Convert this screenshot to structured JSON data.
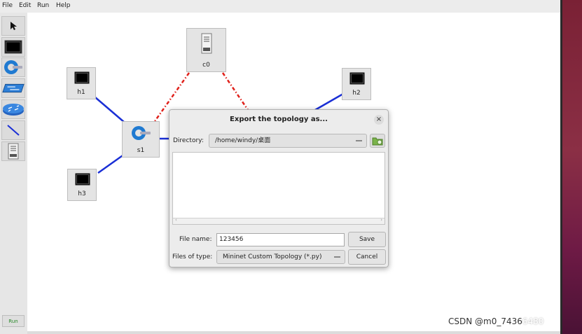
{
  "menu": [
    "File",
    "Edit",
    "Run",
    "Help"
  ],
  "toolbar": {
    "tools": [
      {
        "name": "select-tool",
        "icon": "pointer-arrow-icon"
      },
      {
        "name": "host-tool",
        "icon": "terminal-host-icon"
      },
      {
        "name": "switch-tool",
        "icon": "ovs-switch-icon"
      },
      {
        "name": "legacy-switch-tool",
        "icon": "legacy-switch-icon"
      },
      {
        "name": "legacy-router-tool",
        "icon": "router-icon"
      },
      {
        "name": "link-tool",
        "icon": "link-line-icon"
      },
      {
        "name": "controller-tool",
        "icon": "controller-server-icon"
      }
    ],
    "run_label": "Run"
  },
  "nodes": {
    "h1": "h1",
    "h2": "h2",
    "h3": "h3",
    "s1": "s1",
    "c0": "c0"
  },
  "colors": {
    "data_link": "#1a2fd6",
    "control_link": "#e0201a"
  },
  "dialog": {
    "title": "Export the topology as...",
    "close_icon": "close-icon",
    "directory_label": "Directory:",
    "directory_value": "/home/windy/桌面",
    "filename_label": "File name:",
    "filename_value": "123456",
    "filetype_label": "Files of type:",
    "filetype_value": "Mininet Custom Topology (*.py)",
    "save_label": "Save",
    "cancel_label": "Cancel",
    "scroll_left": "‹",
    "scroll_right": "›"
  },
  "watermark": {
    "prefix": "CSDN @m0_7436",
    "suffix": "6480"
  }
}
